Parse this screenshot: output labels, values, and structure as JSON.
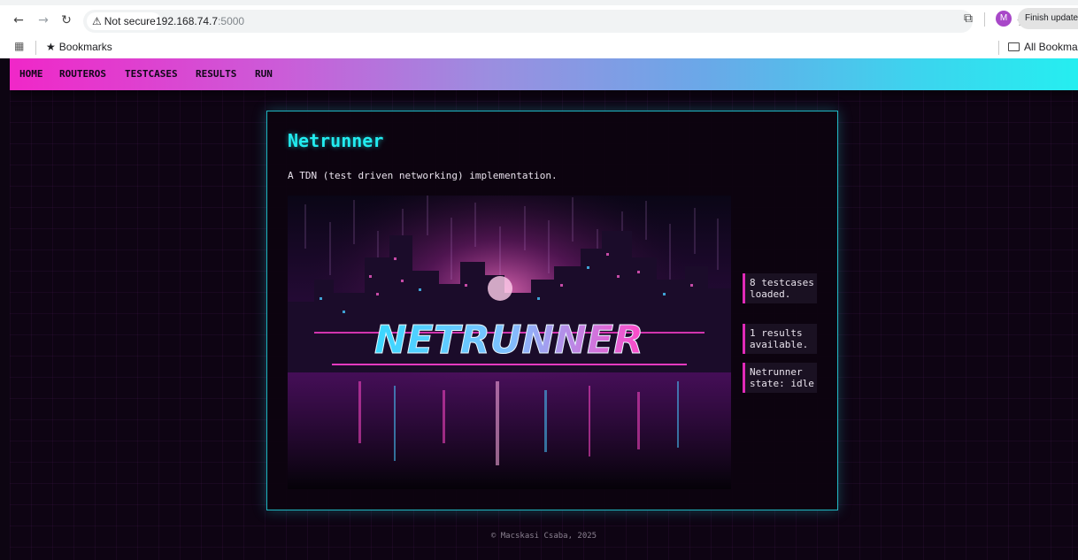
{
  "browser": {
    "security_label": "Not secure",
    "url_host": "192.168.74.7",
    "url_port": ":5000",
    "profile_initial": "M",
    "finish_update_label": "Finish update",
    "bookmarks_label": "Bookmarks",
    "all_bookmarks_label": "All Bookmarks"
  },
  "nav": {
    "items": [
      "HOME",
      "ROUTEROS",
      "TESTCASES",
      "RESULTS",
      "RUN"
    ]
  },
  "main": {
    "title": "Netrunner",
    "subtitle": "A TDN (test driven networking) implementation.",
    "hero_logo_text": "NETRUNNER",
    "status": [
      "8 testcases loaded.",
      "1 results available.",
      "Netrunner state: idle"
    ]
  },
  "footer": {
    "text": "© Macskasi Csaba, 2025"
  },
  "colors": {
    "accent_cyan": "#22ecf0",
    "accent_pink": "#e02ab8",
    "background": "#0e0413"
  }
}
